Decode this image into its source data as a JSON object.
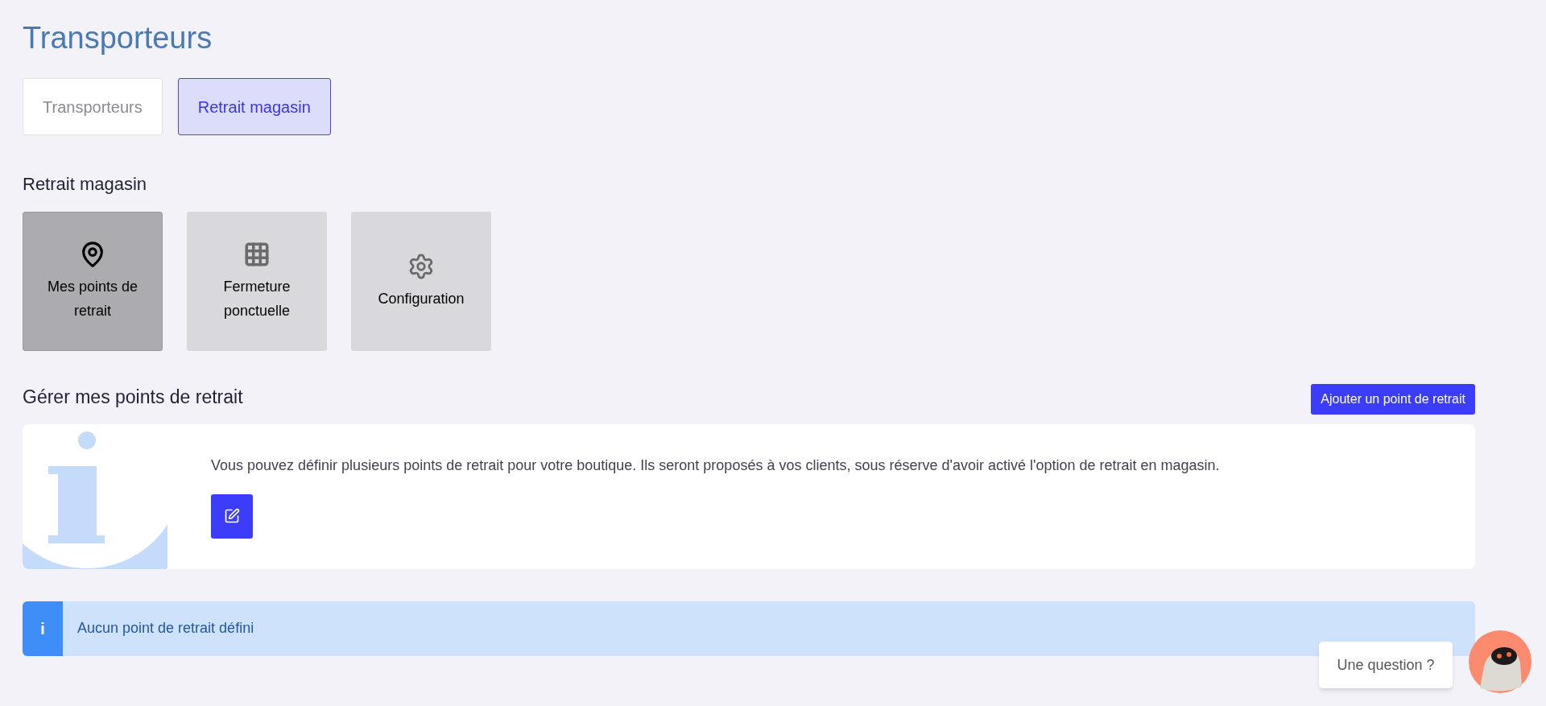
{
  "page_title": "Transporteurs",
  "tabs": [
    {
      "label": "Transporteurs",
      "selected": false
    },
    {
      "label": "Retrait magasin",
      "selected": true
    }
  ],
  "section_title": "Retrait magasin",
  "tiles": [
    {
      "label": "Mes points de retrait",
      "selected": true
    },
    {
      "label": "Fermeture ponctuelle",
      "selected": false
    },
    {
      "label": "Configuration",
      "selected": false
    }
  ],
  "manage": {
    "title": "Gérer mes points de retrait",
    "add_button": "Ajouter un point de retrait",
    "info_text": "Vous pouvez définir plusieurs points de retrait pour votre boutique. Ils seront proposés à vos clients, sous réserve d'avoir activé l'option de retrait en magasin."
  },
  "alert": {
    "icon": "i",
    "text": "Aucun point de retrait défini"
  },
  "chat": {
    "label": "Une question ?"
  }
}
